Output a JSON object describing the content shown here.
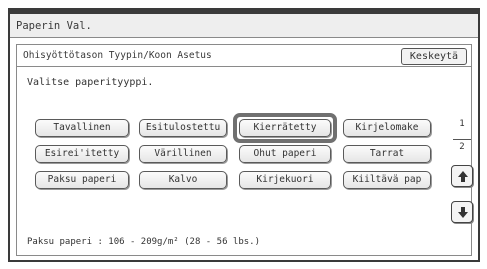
{
  "window": {
    "title": "Paperin Val."
  },
  "panel": {
    "header": "Ohisyöttötason Tyypin/Koon Asetus",
    "cancel_label": "Keskeytä",
    "prompt": "Valitse paperityyppi."
  },
  "paper_types": [
    {
      "label": "Tavallinen",
      "selected": false
    },
    {
      "label": "Esitulostettu",
      "selected": false
    },
    {
      "label": "Kierrätetty",
      "selected": true
    },
    {
      "label": "Kirjelomake",
      "selected": false
    },
    {
      "label": "Esirei'itetty",
      "selected": false
    },
    {
      "label": "Värillinen",
      "selected": false
    },
    {
      "label": "Ohut paperi",
      "selected": false
    },
    {
      "label": "Tarrat",
      "selected": false
    },
    {
      "label": "Paksu paperi",
      "selected": false
    },
    {
      "label": "Kalvo",
      "selected": false
    },
    {
      "label": "Kirjekuori",
      "selected": false
    },
    {
      "label": "Kiiltävä pap",
      "selected": false
    }
  ],
  "pagination": {
    "current": "1",
    "total": "2"
  },
  "icons": {
    "page_up": "up-arrow-icon",
    "page_down": "down-arrow-icon"
  },
  "status_text": "Paksu paperi : 106 - 209g/m² (28 - 56 lbs.)",
  "colors": {
    "border": "#3a3a3a",
    "highlight": "#707070",
    "title_bg": "#eeeeee"
  }
}
